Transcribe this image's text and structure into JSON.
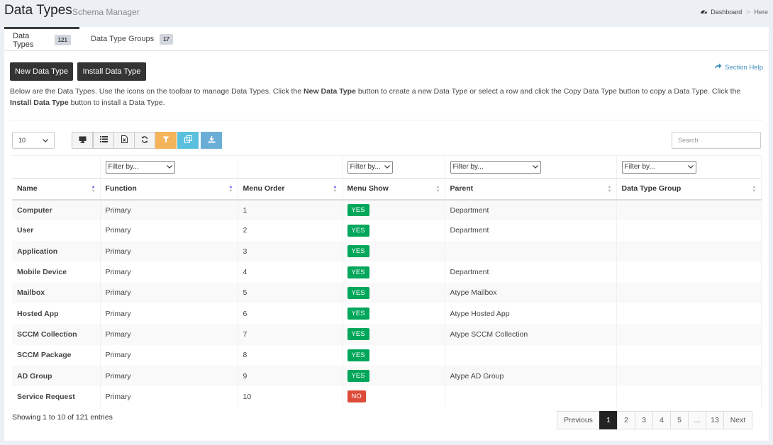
{
  "header": {
    "title": "Data Types",
    "subtitle": "Schema Manager"
  },
  "breadcrumb": {
    "dashboard": "Dashboard",
    "separator": ">",
    "current": "Here"
  },
  "tabs": [
    {
      "label": "Data Types",
      "count": "121"
    },
    {
      "label": "Data Type Groups",
      "count": "17"
    }
  ],
  "actions": {
    "new_label": "New Data Type",
    "install_label": "Install Data Type",
    "help_label": "Section Help"
  },
  "description": {
    "part1": "Below are the Data Types. Use the icons on the toolbar to manage Data Types. Click the ",
    "bold1": "New Data Type",
    "part2": " button to create a new Data Type or select a row and click the Copy Data Type button to copy a Data Type. Click the ",
    "bold2": "Install Data Type",
    "part3": " button to install a Data Type."
  },
  "toolbar": {
    "page_length": "10",
    "search_placeholder": "Search",
    "icons": [
      "monitor-icon",
      "list-icon",
      "export-icon",
      "refresh-icon",
      "filter-icon",
      "copy-icon",
      "download-icon"
    ]
  },
  "filters": {
    "placeholder": "Filter by..."
  },
  "columns": [
    "Name",
    "Function",
    "Menu Order",
    "Menu Show",
    "Parent",
    "Data Type Group"
  ],
  "rows": [
    {
      "name": "Computer",
      "function": "Primary",
      "order": "1",
      "show": "YES",
      "parent": "Department",
      "group": ""
    },
    {
      "name": "User",
      "function": "Primary",
      "order": "2",
      "show": "YES",
      "parent": "Department",
      "group": ""
    },
    {
      "name": "Application",
      "function": "Primary",
      "order": "3",
      "show": "YES",
      "parent": "",
      "group": ""
    },
    {
      "name": "Mobile Device",
      "function": "Primary",
      "order": "4",
      "show": "YES",
      "parent": "Department",
      "group": ""
    },
    {
      "name": "Mailbox",
      "function": "Primary",
      "order": "5",
      "show": "YES",
      "parent": "Atype Mailbox",
      "group": ""
    },
    {
      "name": "Hosted App",
      "function": "Primary",
      "order": "6",
      "show": "YES",
      "parent": "Atype Hosted App",
      "group": ""
    },
    {
      "name": "SCCM Collection",
      "function": "Primary",
      "order": "7",
      "show": "YES",
      "parent": "Atype SCCM Collection",
      "group": ""
    },
    {
      "name": "SCCM Package",
      "function": "Primary",
      "order": "8",
      "show": "YES",
      "parent": "",
      "group": ""
    },
    {
      "name": "AD Group",
      "function": "Primary",
      "order": "9",
      "show": "YES",
      "parent": "Atype AD Group",
      "group": ""
    },
    {
      "name": "Service Request",
      "function": "Primary",
      "order": "10",
      "show": "NO",
      "parent": "",
      "group": ""
    }
  ],
  "footer": {
    "info": "Showing 1 to 10 of 121 entries",
    "pages": [
      "Previous",
      "1",
      "2",
      "3",
      "4",
      "5",
      "…",
      "13",
      "Next"
    ],
    "active_page": "1"
  },
  "colors": {
    "yes": "#00a65a",
    "no": "#dd4b39",
    "accent": "#3c8dbc",
    "dark_button": "#343434"
  }
}
